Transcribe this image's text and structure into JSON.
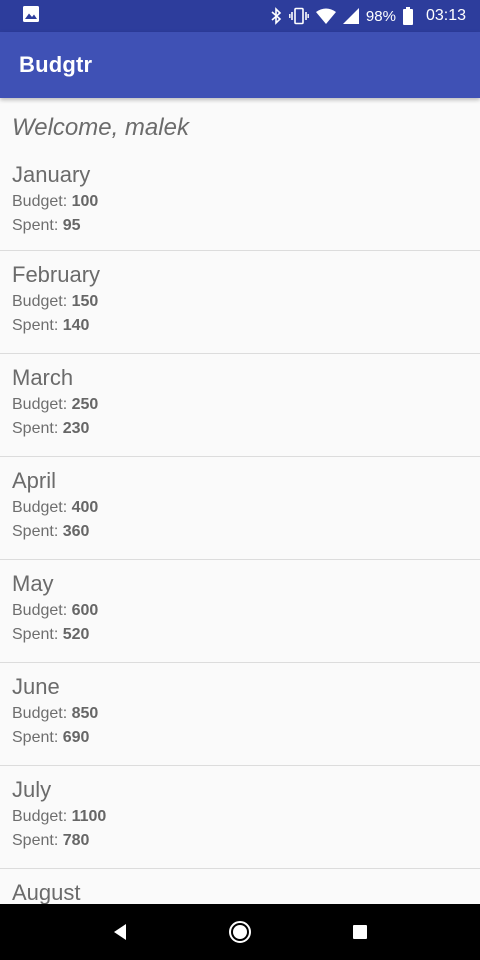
{
  "status_bar": {
    "battery_percent": "98%",
    "time": "03:13",
    "icons": [
      "image-notification-icon",
      "bluetooth-icon",
      "vibrate-icon",
      "wifi-icon",
      "cellular-signal-icon",
      "battery-icon"
    ]
  },
  "app_bar": {
    "title": "Budgtr"
  },
  "welcome": {
    "text": "Welcome, malek"
  },
  "labels": {
    "budget": "Budget: ",
    "spent": "Spent: "
  },
  "months": [
    {
      "name": "January",
      "budget": "100",
      "spent": "95"
    },
    {
      "name": "February",
      "budget": "150",
      "spent": "140"
    },
    {
      "name": "March",
      "budget": "250",
      "spent": "230"
    },
    {
      "name": "April",
      "budget": "400",
      "spent": "360"
    },
    {
      "name": "May",
      "budget": "600",
      "spent": "520"
    },
    {
      "name": "June",
      "budget": "850",
      "spent": "690"
    },
    {
      "name": "July",
      "budget": "1100",
      "spent": "780"
    },
    {
      "name": "August",
      "budget": "",
      "spent": ""
    }
  ],
  "nav_bar": {
    "buttons": [
      "back-icon",
      "home-icon",
      "recents-icon"
    ]
  },
  "colors": {
    "status_bar": "#2d3d9c",
    "app_bar": "#3f51b5",
    "background": "#fafafa",
    "nav_bar": "#000000"
  }
}
